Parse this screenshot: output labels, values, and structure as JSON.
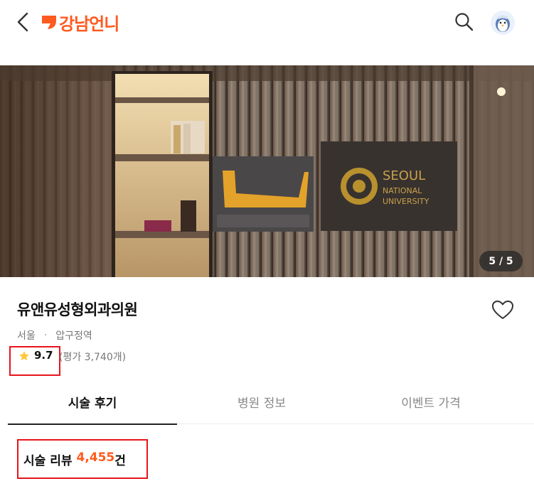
{
  "header": {
    "brand": "강남언니"
  },
  "gallery": {
    "counter": "5 / 5",
    "sign_top": "SEOUL",
    "sign_mid": "NATIONAL",
    "sign_bottom": "UNIVERSITY"
  },
  "clinic": {
    "name": "유앤유성형외과의원",
    "city": "서울",
    "separator": "·",
    "area": "압구정역",
    "rating": "9.7",
    "rating_count": "(평가 3,740개)"
  },
  "tabs": [
    {
      "label": "시술 후기"
    },
    {
      "label": "병원 정보"
    },
    {
      "label": "이벤트 가격"
    }
  ],
  "reviews": {
    "heading": "시술 리뷰",
    "count": "4,455",
    "unit": "건"
  },
  "colors": {
    "brand": "#ff5a1f",
    "highlight_border": "#e8141b"
  },
  "icons": [
    "back-icon",
    "brand-logo-icon",
    "search-icon",
    "avatar",
    "heart-icon",
    "star-icon"
  ]
}
